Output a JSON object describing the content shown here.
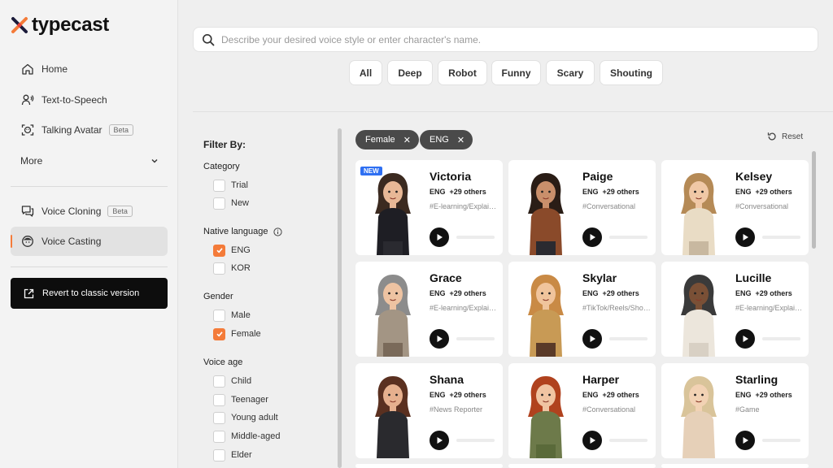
{
  "brand": {
    "name": "typecast",
    "accent": "#f47b39"
  },
  "sidebar": {
    "items": [
      {
        "label": "Home",
        "icon": "home-icon"
      },
      {
        "label": "Text-to-Speech",
        "icon": "text-to-speech-icon"
      },
      {
        "label": "Talking Avatar",
        "icon": "avatar-face-icon",
        "badge": "Beta"
      }
    ],
    "more_label": "More",
    "bottom_items": [
      {
        "label": "Voice Cloning",
        "icon": "chat-icon",
        "badge": "Beta"
      },
      {
        "label": "Voice Casting",
        "icon": "person-icon",
        "active": true
      }
    ],
    "revert_label": "Revert to classic version"
  },
  "search": {
    "placeholder": "Describe your desired voice style or enter character's name."
  },
  "style_chips": [
    "All",
    "Deep",
    "Robot",
    "Funny",
    "Scary",
    "Shouting"
  ],
  "filters": {
    "title": "Filter By:",
    "groups": [
      {
        "heading": "Category",
        "options": [
          {
            "label": "Trial",
            "checked": false
          },
          {
            "label": "New",
            "checked": false
          }
        ]
      },
      {
        "heading": "Native language",
        "info": true,
        "options": [
          {
            "label": "ENG",
            "checked": true
          },
          {
            "label": "KOR",
            "checked": false
          }
        ]
      },
      {
        "heading": "Gender",
        "options": [
          {
            "label": "Male",
            "checked": false
          },
          {
            "label": "Female",
            "checked": true
          }
        ]
      },
      {
        "heading": "Voice age",
        "options": [
          {
            "label": "Child",
            "checked": false
          },
          {
            "label": "Teenager",
            "checked": false
          },
          {
            "label": "Young adult",
            "checked": false
          },
          {
            "label": "Middle-aged",
            "checked": false
          },
          {
            "label": "Elder",
            "checked": false
          }
        ]
      }
    ]
  },
  "active_tags": [
    "Female",
    "ENG"
  ],
  "reset_label": "Reset",
  "new_badge": "NEW",
  "voices": [
    {
      "name": "Victoria",
      "lang": "ENG",
      "others": "+29 others",
      "tag": "#E-learning/Explainer",
      "is_new": true
    },
    {
      "name": "Paige",
      "lang": "ENG",
      "others": "+29 others",
      "tag": "#Conversational"
    },
    {
      "name": "Kelsey",
      "lang": "ENG",
      "others": "+29 others",
      "tag": "#Conversational"
    },
    {
      "name": "Grace",
      "lang": "ENG",
      "others": "+29 others",
      "tag": "#E-learning/Explainer"
    },
    {
      "name": "Skylar",
      "lang": "ENG",
      "others": "+29 others",
      "tag": "#TikTok/Reels/Shorts"
    },
    {
      "name": "Lucille",
      "lang": "ENG",
      "others": "+29 others",
      "tag": "#E-learning/Explainer"
    },
    {
      "name": "Shana",
      "lang": "ENG",
      "others": "+29 others",
      "tag": "#News Reporter"
    },
    {
      "name": "Harper",
      "lang": "ENG",
      "others": "+29 others",
      "tag": "#Conversational"
    },
    {
      "name": "Starling",
      "lang": "ENG",
      "others": "+29 others",
      "tag": "#Game"
    }
  ]
}
